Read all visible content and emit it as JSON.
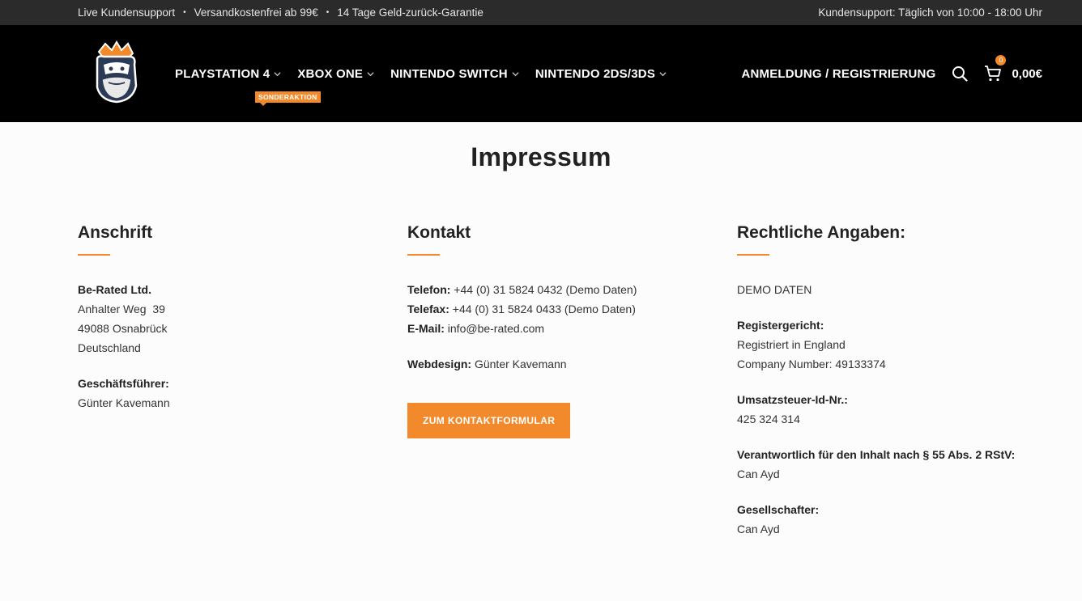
{
  "topbar": {
    "left_items": [
      "Live Kundensupport",
      "Versandkostenfrei ab 99€",
      "14 Tage Geld-zurück-Garantie"
    ],
    "separator": "•",
    "right_text": "Kundensupport: Täglich von 10:00 - 18:00 Uhr"
  },
  "header": {
    "logo_icon": "king-mascot-logo",
    "nav": [
      {
        "label": "PLAYSTATION 4",
        "badge": "SONDERAKTION"
      },
      {
        "label": "XBOX ONE"
      },
      {
        "label": "NINTENDO SWITCH"
      },
      {
        "label": "NINTENDO 2DS/3DS"
      }
    ],
    "login_label": "ANMELDUNG / REGISTRIERUNG",
    "cart_count": "0",
    "cart_total": "0,00€",
    "accent_color": "#f2892b"
  },
  "page": {
    "title": "Impressum",
    "anschrift": {
      "heading": "Anschrift",
      "company": "Be-Rated Ltd.",
      "street": "Anhalter Weg  39",
      "city": "49088 Osnabrück",
      "country": "Deutschland",
      "ceo_label": "Geschäftsführer:",
      "ceo_name": "Günter Kavemann"
    },
    "kontakt": {
      "heading": "Kontakt",
      "phone_label": "Telefon:",
      "phone_value": "+44 (0) 31 5824 0432 (Demo Daten)",
      "fax_label": "Telefax:",
      "fax_value": "+44 (0) 31 5824 0433 (Demo Daten)",
      "email_label": "E-Mail:",
      "email_value": "info@be-rated.com",
      "webdesign_label": "Webdesign:",
      "webdesign_value": "Günter Kavemann",
      "button_label": "ZUM KONTAKTFORMULAR"
    },
    "rechtliches": {
      "heading": "Rechtliche Angaben:",
      "demo": "DEMO DATEN",
      "court_label": "Registergericht:",
      "court_line1": "Registriert in England",
      "court_line2": "Company Number: 49133374",
      "vat_label": "Umsatzsteuer-Id-Nr.:",
      "vat_value": "425 324 314",
      "resp_label": "Verantwortlich für den Inhalt nach § 55 Abs. 2 RStV:",
      "resp_value": "Can Ayd",
      "partner_label": "Gesellschafter:",
      "partner_value": "Can Ayd"
    }
  }
}
